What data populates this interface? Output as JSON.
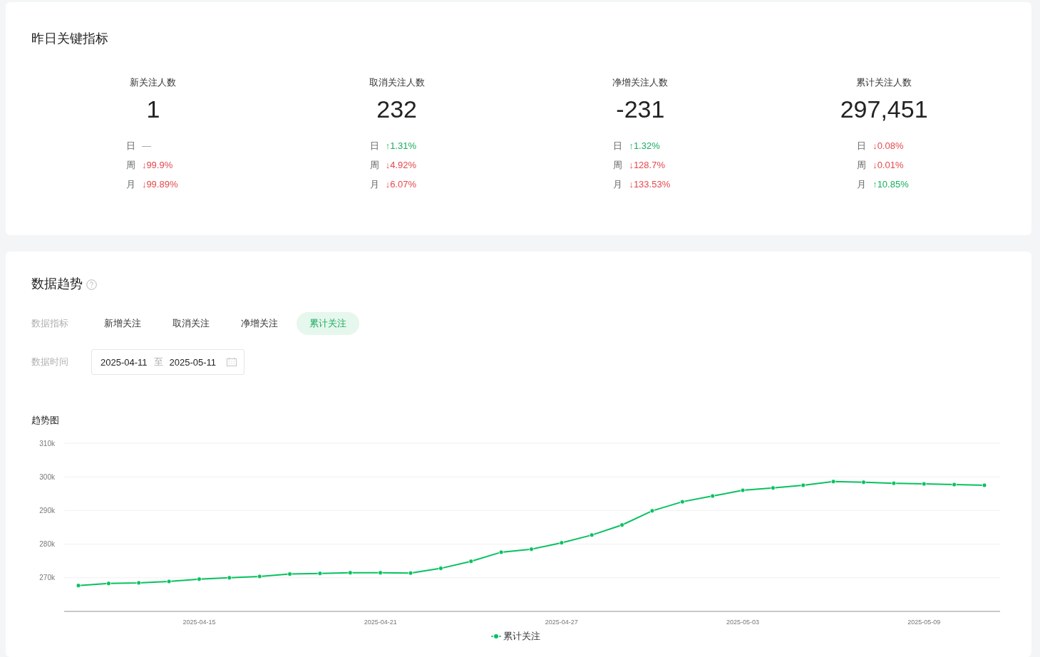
{
  "key_metrics": {
    "title": "昨日关键指标",
    "metrics": [
      {
        "label": "新关注人数",
        "value": "1",
        "compare": [
          {
            "period": "日",
            "change": "—",
            "color": "#a0a0a0"
          },
          {
            "period": "周",
            "change": "↓99.9%",
            "color": "#e5484d"
          },
          {
            "period": "月",
            "change": "↓99.89%",
            "color": "#e5484d"
          }
        ]
      },
      {
        "label": "取消关注人数",
        "value": "232",
        "compare": [
          {
            "period": "日",
            "change": "↑1.31%",
            "color": "#1aad5f"
          },
          {
            "period": "周",
            "change": "↓4.92%",
            "color": "#e5484d"
          },
          {
            "period": "月",
            "change": "↓6.07%",
            "color": "#e5484d"
          }
        ]
      },
      {
        "label": "净增关注人数",
        "value": "-231",
        "compare": [
          {
            "period": "日",
            "change": "↑1.32%",
            "color": "#1aad5f"
          },
          {
            "period": "周",
            "change": "↓128.7%",
            "color": "#e5484d"
          },
          {
            "period": "月",
            "change": "↓133.53%",
            "color": "#e5484d"
          }
        ]
      },
      {
        "label": "累计关注人数",
        "value": "297,451",
        "compare": [
          {
            "period": "日",
            "change": "↓0.08%",
            "color": "#e5484d"
          },
          {
            "period": "周",
            "change": "↓0.01%",
            "color": "#e5484d"
          },
          {
            "period": "月",
            "change": "↑10.85%",
            "color": "#1aad5f"
          }
        ]
      }
    ]
  },
  "trend": {
    "title": "数据趋势",
    "metric_label": "数据指标",
    "tabs": [
      {
        "label": "新增关注",
        "selected": false
      },
      {
        "label": "取消关注",
        "selected": false
      },
      {
        "label": "净增关注",
        "selected": false
      },
      {
        "label": "累计关注",
        "selected": true
      }
    ],
    "time_label": "数据时间",
    "date_range": {
      "start": "2025-04-11",
      "separator": "至",
      "end": "2025-05-11"
    },
    "chart_title": "趋势图",
    "chart_data": {
      "type": "line",
      "grid": true,
      "categories": [
        null,
        null,
        null,
        null,
        "2025-04-15",
        null,
        null,
        null,
        null,
        null,
        "2025-04-21",
        null,
        null,
        null,
        null,
        null,
        "2025-04-27",
        null,
        null,
        null,
        null,
        null,
        "2025-05-03",
        null,
        null,
        null,
        null,
        null,
        "2025-05-09",
        null,
        null
      ],
      "series": [
        {
          "name": "累计关注",
          "color": "#07c160",
          "marker": "circle",
          "values": [
            267700,
            268300,
            268500,
            268900,
            269600,
            270000,
            270400,
            271100,
            271300,
            271500,
            271500,
            271400,
            272800,
            274900,
            277600,
            278500,
            280400,
            282700,
            285700,
            289900,
            292600,
            294300,
            296000,
            296700,
            297500,
            298600,
            298400,
            298100,
            297900,
            297700,
            297500
          ]
        }
      ],
      "ylim": [
        260000,
        310000
      ],
      "yticks": [
        {
          "value": 270000,
          "label": "270k"
        },
        {
          "value": 280000,
          "label": "280k"
        },
        {
          "value": 290000,
          "label": "290k"
        },
        {
          "value": 300000,
          "label": "300k"
        },
        {
          "value": 310000,
          "label": "310k"
        }
      ]
    }
  }
}
